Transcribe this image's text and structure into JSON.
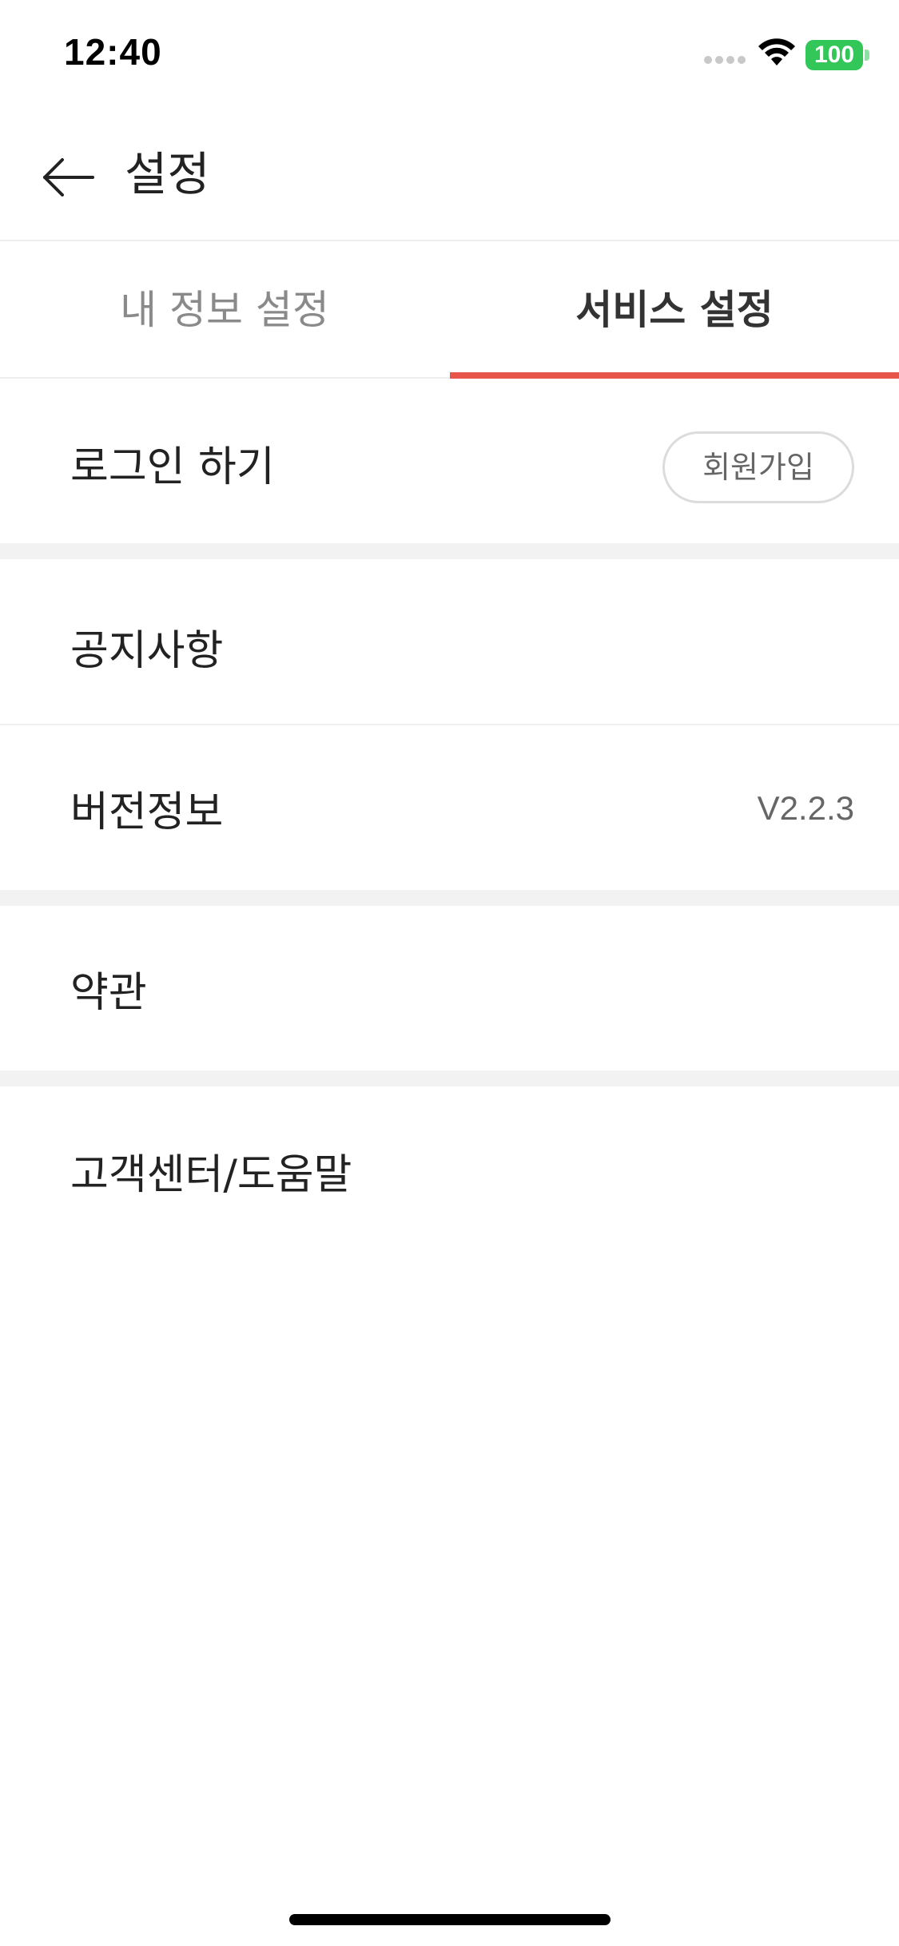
{
  "status_bar": {
    "time": "12:40",
    "battery": "100",
    "battery_color": "#33c659"
  },
  "header": {
    "back_icon": "arrow-left-icon",
    "title": "설정"
  },
  "tabs": [
    {
      "label": "내 정보 설정",
      "active": false
    },
    {
      "label": "서비스 설정",
      "active": true
    }
  ],
  "accent_color": "#e8554a",
  "rows": {
    "login": {
      "label": "로그인 하기",
      "button": "회원가입"
    },
    "notice": {
      "label": "공지사항"
    },
    "version": {
      "label": "버전정보",
      "value": "V2.2.3"
    },
    "terms": {
      "label": "약관"
    },
    "support": {
      "label": "고객센터/도움말"
    }
  }
}
